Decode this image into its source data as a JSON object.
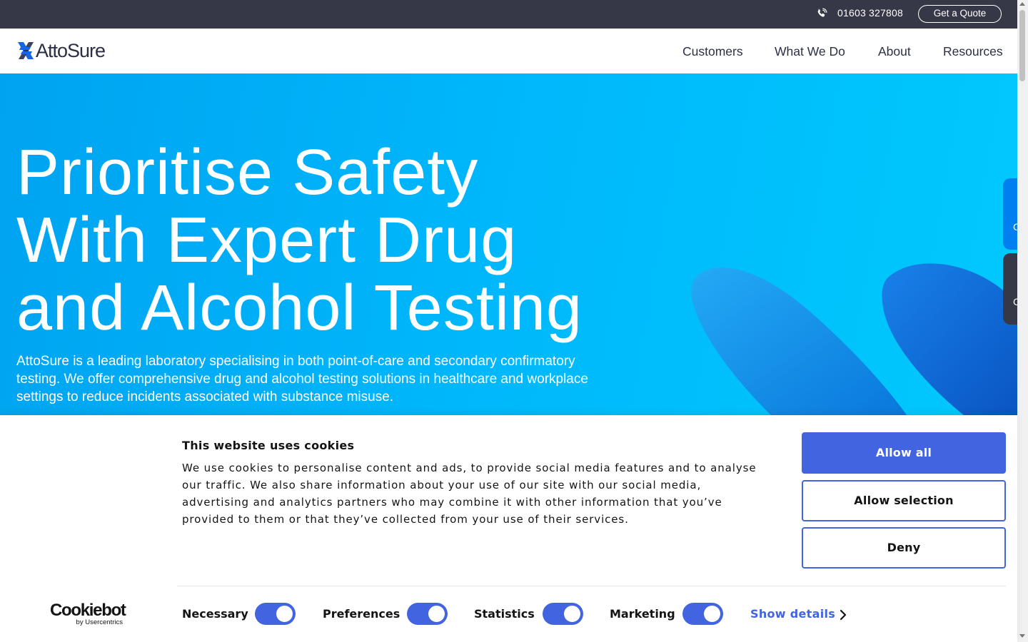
{
  "topbar": {
    "phone_icon": "phone-icon",
    "phone_number": "01603 327808",
    "quote_button": "Get a Quote"
  },
  "navbar": {
    "logo_text": "AttoSure",
    "logo_icon": "attosure-logo-icon",
    "items": [
      {
        "label": "Customers"
      },
      {
        "label": "What We Do"
      },
      {
        "label": "About"
      },
      {
        "label": "Resources"
      }
    ]
  },
  "hero": {
    "title_lines": [
      "Prioritise Safety",
      "With Expert Drug",
      "and Alcohol Testing"
    ],
    "description": "AttoSure is a leading laboratory specialising in both point-of-care and secondary confirmatory testing. We offer comprehensive drug and alcohol testing solutions in healthcare and workplace settings to reduce incidents associated with substance misuse.",
    "side_tabs": [
      {
        "color": "#0080f0",
        "glyph": "C"
      },
      {
        "color": "#363847",
        "glyph": "C"
      }
    ]
  },
  "cookie_banner": {
    "title": "This website uses cookies",
    "text": "We use cookies to personalise content and ads, to provide social media features and to analyse our traffic. We also share information about your use of our site with our social media, advertising and analytics partners who may combine it with other information that you’ve provided to them or that they’ve collected from your use of their services.",
    "buttons": {
      "allow_all": "Allow all",
      "allow_selection": "Allow selection",
      "deny": "Deny"
    },
    "brand": {
      "name": "Cookiebot",
      "sub": "by Usercentrics"
    },
    "consents": [
      {
        "label": "Necessary",
        "enabled": true
      },
      {
        "label": "Preferences",
        "enabled": true
      },
      {
        "label": "Statistics",
        "enabled": true
      },
      {
        "label": "Marketing",
        "enabled": true
      }
    ],
    "show_details": "Show details",
    "accent_color": "#4264e0"
  },
  "colors": {
    "topbar": "#363847",
    "hero_gradient_start": "#00a3f0",
    "hero_gradient_end": "#00c9fd",
    "nav_text": "#2b2f45"
  }
}
